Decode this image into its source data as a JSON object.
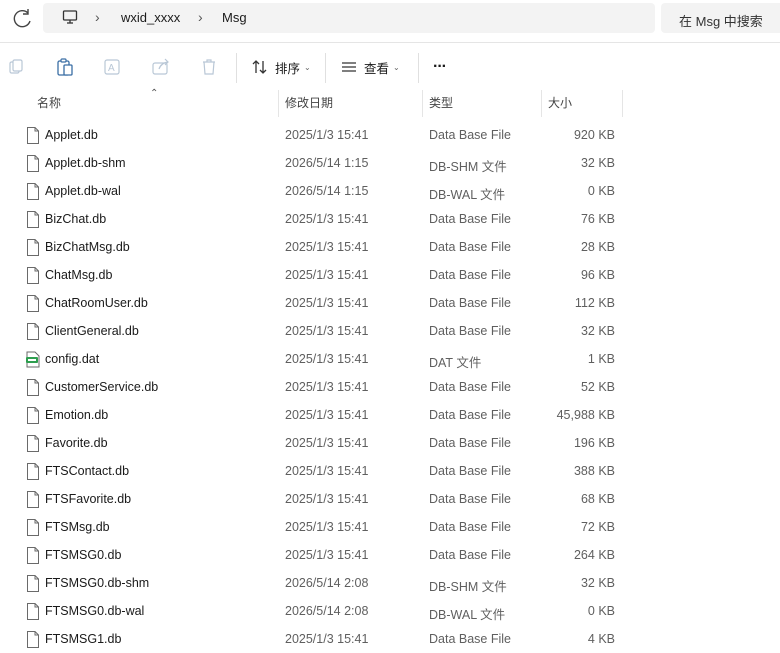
{
  "address": {
    "crumbs": [
      "wxid_xxxx",
      "Msg"
    ],
    "search_placeholder": "在 Msg 中搜索"
  },
  "toolbar": {
    "sort_label": "排序",
    "view_label": "查看",
    "more_label": "···"
  },
  "columns": {
    "name": "名称",
    "date": "修改日期",
    "type": "类型",
    "size": "大小"
  },
  "files": [
    {
      "name": "Applet.db",
      "date": "2025/1/3 15:41",
      "type": "Data Base File",
      "size": "920 KB",
      "icon": "file-icon"
    },
    {
      "name": "Applet.db-shm",
      "date": "2026/5/14 1:15",
      "type": "DB-SHM 文件",
      "size": "32 KB",
      "icon": "file-icon"
    },
    {
      "name": "Applet.db-wal",
      "date": "2026/5/14 1:15",
      "type": "DB-WAL 文件",
      "size": "0 KB",
      "icon": "file-icon"
    },
    {
      "name": "BizChat.db",
      "date": "2025/1/3 15:41",
      "type": "Data Base File",
      "size": "76 KB",
      "icon": "file-icon"
    },
    {
      "name": "BizChatMsg.db",
      "date": "2025/1/3 15:41",
      "type": "Data Base File",
      "size": "28 KB",
      "icon": "file-icon"
    },
    {
      "name": "ChatMsg.db",
      "date": "2025/1/3 15:41",
      "type": "Data Base File",
      "size": "96 KB",
      "icon": "file-icon"
    },
    {
      "name": "ChatRoomUser.db",
      "date": "2025/1/3 15:41",
      "type": "Data Base File",
      "size": "112 KB",
      "icon": "file-icon"
    },
    {
      "name": "ClientGeneral.db",
      "date": "2025/1/3 15:41",
      "type": "Data Base File",
      "size": "32 KB",
      "icon": "file-icon"
    },
    {
      "name": "config.dat",
      "date": "2025/1/3 15:41",
      "type": "DAT 文件",
      "size": "1 KB",
      "icon": "dat-file-icon"
    },
    {
      "name": "CustomerService.db",
      "date": "2025/1/3 15:41",
      "type": "Data Base File",
      "size": "52 KB",
      "icon": "file-icon"
    },
    {
      "name": "Emotion.db",
      "date": "2025/1/3 15:41",
      "type": "Data Base File",
      "size": "45,988 KB",
      "icon": "file-icon"
    },
    {
      "name": "Favorite.db",
      "date": "2025/1/3 15:41",
      "type": "Data Base File",
      "size": "196 KB",
      "icon": "file-icon"
    },
    {
      "name": "FTSContact.db",
      "date": "2025/1/3 15:41",
      "type": "Data Base File",
      "size": "388 KB",
      "icon": "file-icon"
    },
    {
      "name": "FTSFavorite.db",
      "date": "2025/1/3 15:41",
      "type": "Data Base File",
      "size": "68 KB",
      "icon": "file-icon"
    },
    {
      "name": "FTSMsg.db",
      "date": "2025/1/3 15:41",
      "type": "Data Base File",
      "size": "72 KB",
      "icon": "file-icon"
    },
    {
      "name": "FTSMSG0.db",
      "date": "2025/1/3 15:41",
      "type": "Data Base File",
      "size": "264 KB",
      "icon": "file-icon"
    },
    {
      "name": "FTSMSG0.db-shm",
      "date": "2026/5/14 2:08",
      "type": "DB-SHM 文件",
      "size": "32 KB",
      "icon": "file-icon"
    },
    {
      "name": "FTSMSG0.db-wal",
      "date": "2026/5/14 2:08",
      "type": "DB-WAL 文件",
      "size": "0 KB",
      "icon": "file-icon"
    },
    {
      "name": "FTSMSG1.db",
      "date": "2025/1/3 15:41",
      "type": "Data Base File",
      "size": "4 KB",
      "icon": "file-icon"
    }
  ]
}
